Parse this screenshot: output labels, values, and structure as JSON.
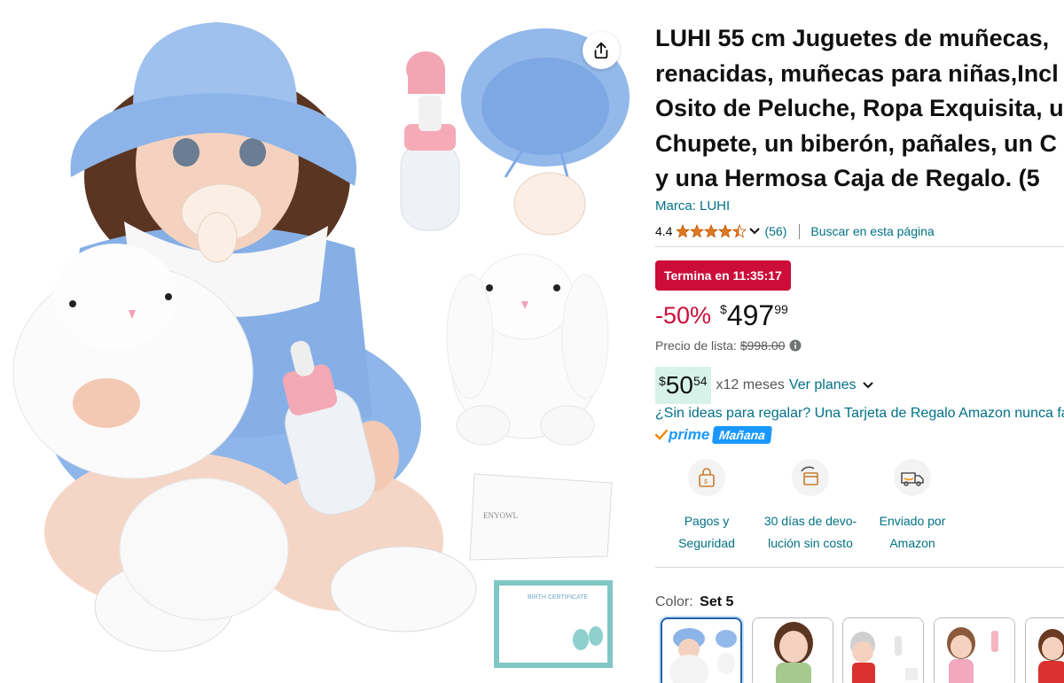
{
  "product": {
    "title_lines": [
      "LUHI 55 cm Juguetes de muñecas,",
      "renacidas, muñecas para niñas,Incl",
      "Osito de Peluche, Ropa Exquisita, u",
      "Chupete, un biberón, pañales, un C",
      "y una Hermosa Caja de Regalo. (5"
    ],
    "brand_label": "Marca: LUHI",
    "rating": "4.4",
    "review_count": "(56)",
    "search_link": "Buscar en esta página",
    "image_texts": {
      "diaper_brand": "ENYOWL",
      "certificate_title": "BIRTH CERTIFICATE"
    }
  },
  "pricing": {
    "deal_badge": "Termina en 11:35:17",
    "discount": "-50%",
    "currency": "$",
    "price_whole": "497",
    "price_fraction": "99",
    "list_price_label": "Precio de lista:",
    "list_price_value": "$998.00",
    "installment_whole": "50",
    "installment_fraction": "54",
    "installment_months": "x12 meses",
    "plans_link": "Ver planes"
  },
  "gift_link": "¿Sin ideas para regalar? Una Tarjeta de Regalo Amazon nunca falla",
  "prime": {
    "label": "prime",
    "badge": "Mañana"
  },
  "features": [
    {
      "icon": "secure-payment-icon",
      "label": "Pagos y Seguridad"
    },
    {
      "icon": "return-box-icon",
      "label": "30 días de devo-lución sin costo"
    },
    {
      "icon": "delivery-truck-icon",
      "label": "Enviado por Amazon"
    }
  ],
  "color_selector": {
    "label": "Color:",
    "selected": "Set 5"
  },
  "colors": {
    "link": "#007185",
    "deal_red": "#cc0c39",
    "prime_blue": "#1a98ff",
    "install_green": "#d7f2e9",
    "swatch_border": "#2162a1"
  }
}
